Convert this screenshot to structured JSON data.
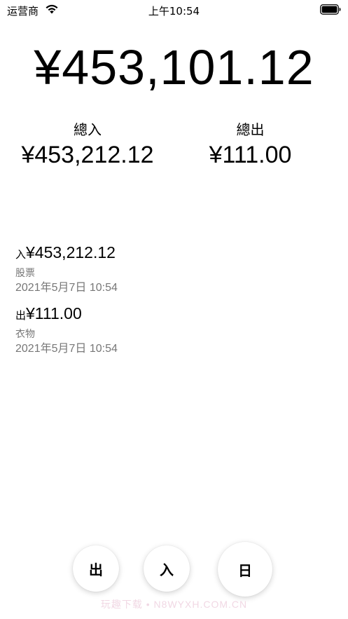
{
  "status_bar": {
    "carrier": "运营商",
    "time": "上午10:54"
  },
  "balance": "¥453,101.12",
  "summary": {
    "income_label": "總入",
    "income_value": "¥453,212.12",
    "expense_label": "總出",
    "expense_value": "¥111.00"
  },
  "transactions": [
    {
      "type": "入",
      "amount": "¥453,212.12",
      "category": "股票",
      "date": "2021年5月7日 10:54"
    },
    {
      "type": "出",
      "amount": "¥111.00",
      "category": "衣物",
      "date": "2021年5月7日 10:54"
    }
  ],
  "buttons": {
    "out_label": "出",
    "in_label": "入",
    "day_label": "日"
  },
  "watermark": "玩趣下载 • N8WYXH.COM.CN"
}
